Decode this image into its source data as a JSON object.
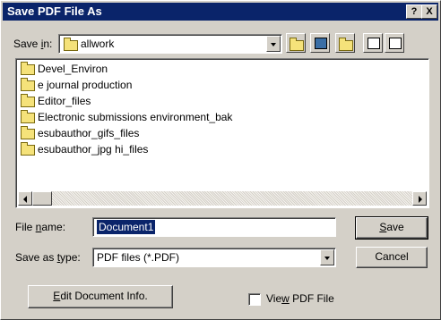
{
  "window": {
    "title": "Save PDF File As",
    "help_button": "?",
    "close_button": "X"
  },
  "save_in": {
    "label_pre": "Save ",
    "label_mnemonic": "i",
    "label_post": "n:",
    "folder": "allwork",
    "folder_icon": "folder-icon"
  },
  "toolbar": {
    "icons": [
      "up-one-level-icon",
      "desktop-icon",
      "create-new-folder-icon",
      "list-view-icon",
      "details-view-icon"
    ]
  },
  "files": [
    {
      "name": "Devel_Environ",
      "icon": "folder-icon"
    },
    {
      "name": "e journal production",
      "icon": "folder-icon"
    },
    {
      "name": "Editor_files",
      "icon": "folder-icon"
    },
    {
      "name": "Electronic submissions environment_bak",
      "icon": "folder-icon"
    },
    {
      "name": "esubauthor_gifs_files",
      "icon": "folder-icon"
    },
    {
      "name": "esubauthor_jpg hi_files",
      "icon": "folder-icon"
    }
  ],
  "file_name": {
    "label_pre": "File ",
    "label_mnemonic": "n",
    "label_post": "ame:",
    "value": "Document1"
  },
  "save_as_type": {
    "label_pre": "Save as ",
    "label_mnemonic": "t",
    "label_post": "ype:",
    "value": "PDF files (*.PDF)"
  },
  "buttons": {
    "save_mnemonic": "S",
    "save_rest": "ave",
    "cancel": "Cancel",
    "edit_doc_mnemonic": "E",
    "edit_doc_rest": "dit Document Info."
  },
  "view_pdf": {
    "label_pre": "Vie",
    "label_mnemonic": "w",
    "label_post": " PDF File",
    "checked": false
  },
  "colors": {
    "titlebar": "#0a246a",
    "face": "#d4d0c8",
    "selection": "#0a246a"
  }
}
